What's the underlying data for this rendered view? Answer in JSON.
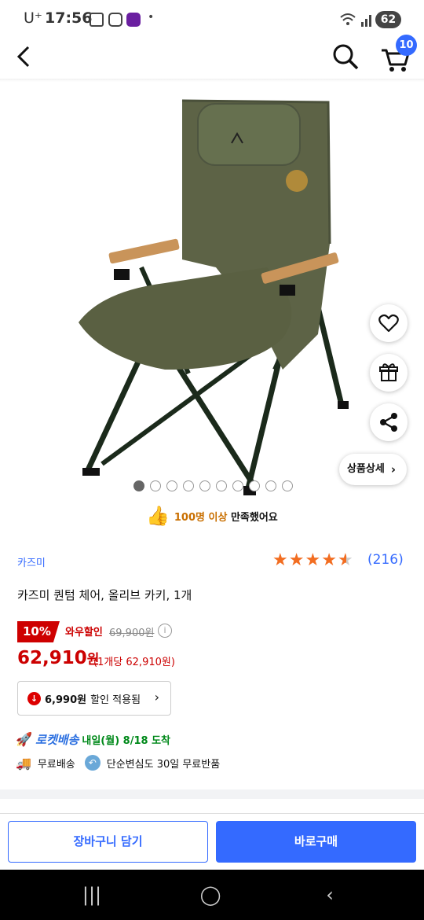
{
  "status_bar": {
    "carrier": "U⁺",
    "time": "17:56",
    "battery": "62"
  },
  "header": {
    "cart_count": "10"
  },
  "gallery": {
    "total_images": 10,
    "active_index": 0
  },
  "float_buttons": {
    "detail_label": "상품상세"
  },
  "satisfaction": {
    "highlight": "100명 이상",
    "rest": " 만족했어요"
  },
  "product": {
    "brand": "카즈미",
    "rating": 4.5,
    "review_count": "(216)",
    "title": "카즈미 퀀텀 체어, 올리브 카키, 1개",
    "discount_rate": "10%",
    "discount_label": "와우할인",
    "original_price": "69,900원",
    "info_icon": "i",
    "price_value": "62,910",
    "price_unit": "원",
    "unit_price": "(1개당 62,910원)"
  },
  "coupon": {
    "amount": "6,990원",
    "label": "할인 적용됨"
  },
  "shipping": {
    "rocket_label": "로켓배송",
    "eta": "내일(월) 8/18 도착",
    "free_shipping": "무료배송",
    "return_policy": "단순변심도 30일 무료반품"
  },
  "actions": {
    "add_to_cart": "장바구니 담기",
    "buy_now": "바로구매"
  },
  "colors": {
    "accent": "#346aff",
    "sale": "#cc0000",
    "star": "#f26d21",
    "rocket_eta": "#00891a"
  }
}
